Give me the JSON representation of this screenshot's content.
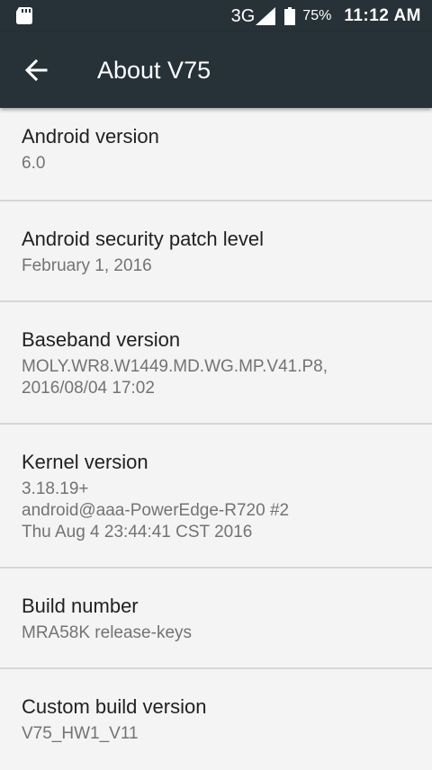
{
  "status_bar": {
    "network": "3G",
    "battery": "75%",
    "time": "11:12 AM",
    "icons": [
      "sd-card-icon",
      "signal-icon",
      "battery-icon"
    ]
  },
  "app_bar": {
    "back_icon": "arrow-back-icon",
    "title": "About V75"
  },
  "items": [
    {
      "title": "Android version",
      "summary": "6.0"
    },
    {
      "title": "Android security patch level",
      "summary": "February 1, 2016"
    },
    {
      "title": "Baseband version",
      "summary": "MOLY.WR8.W1449.MD.WG.MP.V41.P8,\n2016/08/04 17:02"
    },
    {
      "title": "Kernel version",
      "summary": "3.18.19+\nandroid@aaa-PowerEdge-R720 #2\nThu Aug 4 23:44:41 CST 2016"
    },
    {
      "title": "Build number",
      "summary": "MRA58K release-keys"
    },
    {
      "title": "Custom build version",
      "summary": "V75_HW1_V11"
    }
  ],
  "colors": {
    "toolbar": "#263238",
    "background": "#f4f4f4",
    "title_text": "#212121",
    "summary_text": "#737373",
    "divider": "#d6d6d6"
  }
}
